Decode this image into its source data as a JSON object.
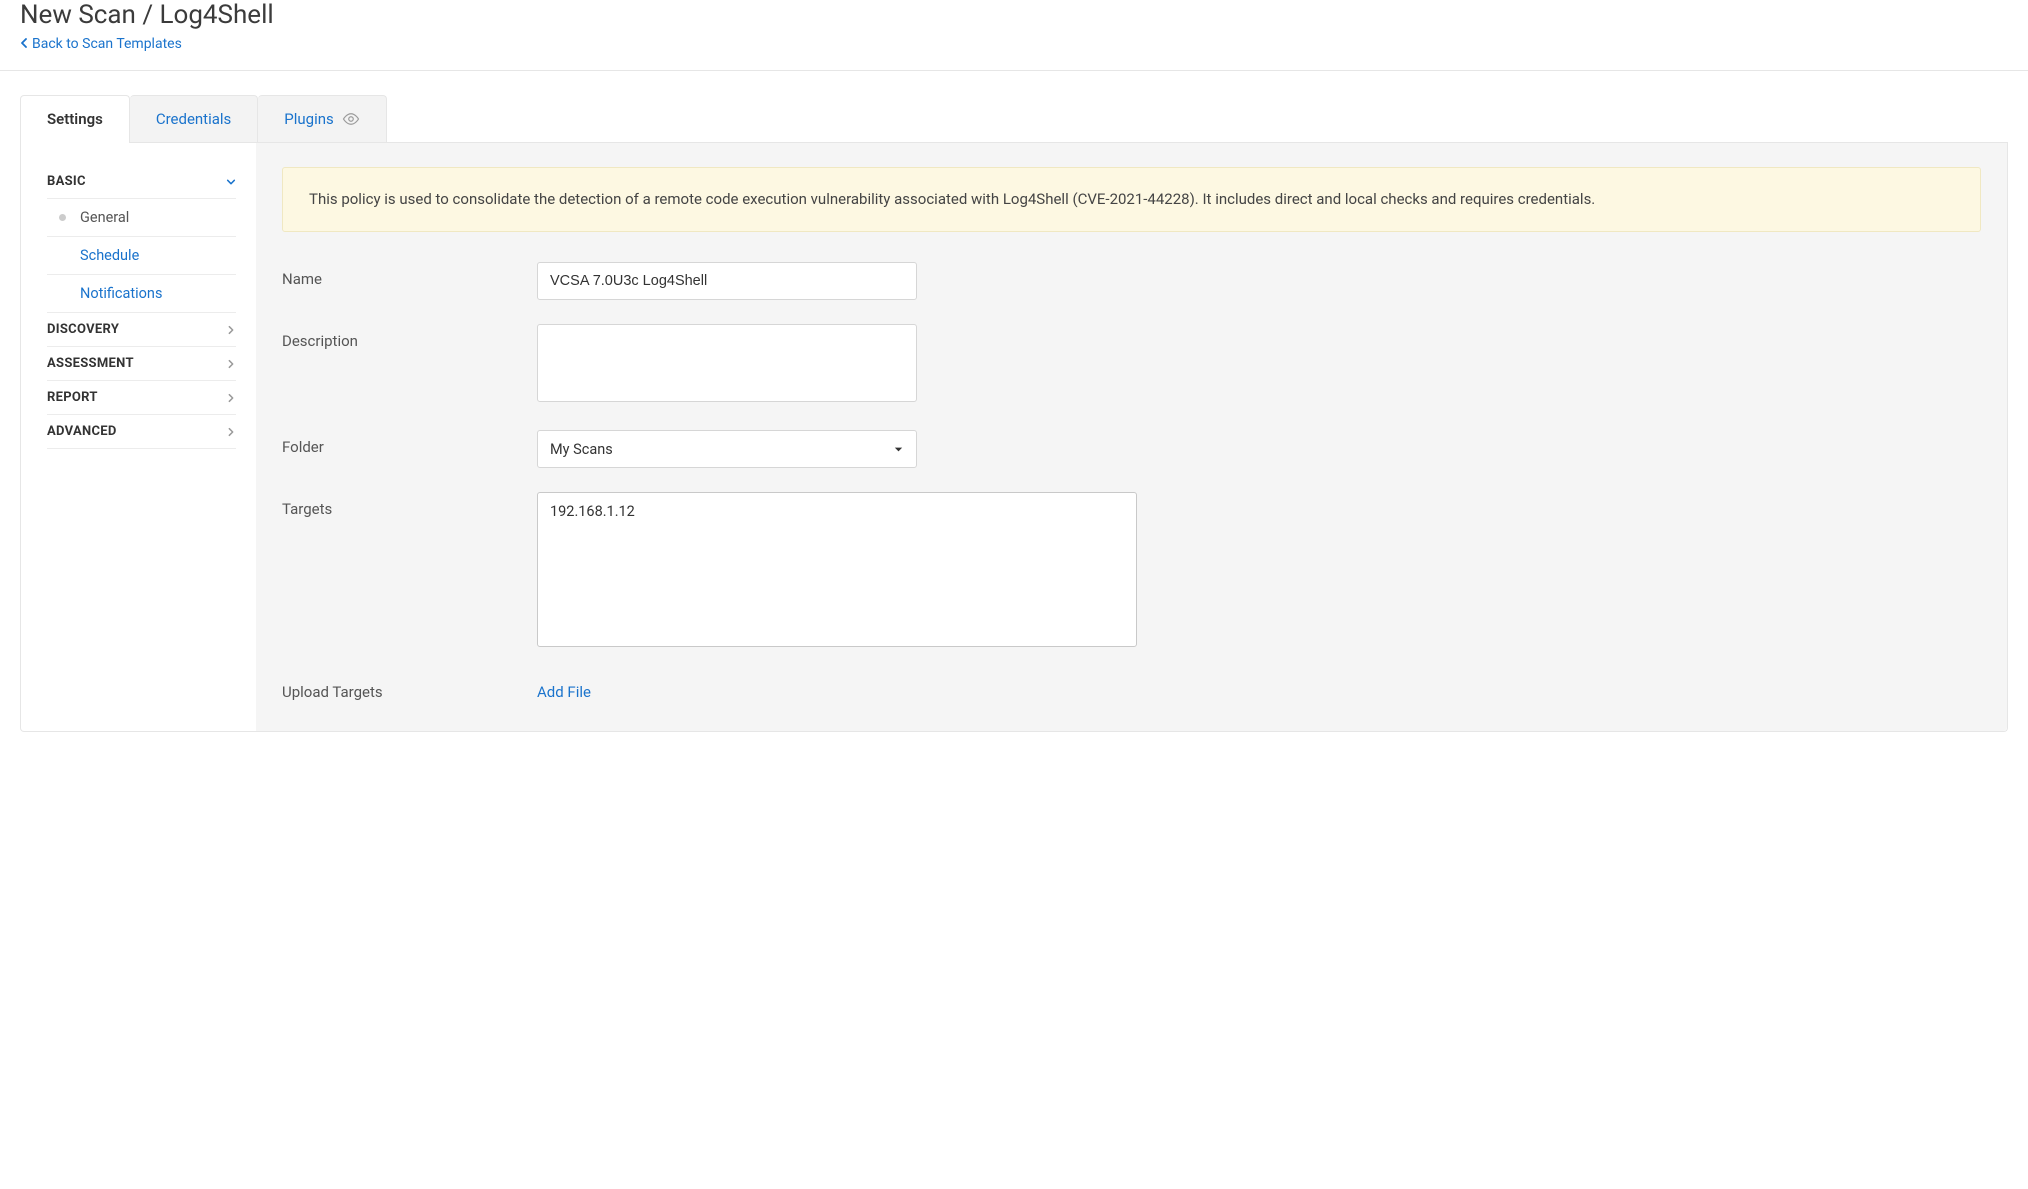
{
  "header": {
    "title": "New Scan / Log4Shell",
    "back_label": "Back to Scan Templates"
  },
  "tabs": {
    "settings": "Settings",
    "credentials": "Credentials",
    "plugins": "Plugins"
  },
  "sidebar": {
    "sections": {
      "basic": "BASIC",
      "discovery": "DISCOVERY",
      "assessment": "ASSESSMENT",
      "report": "REPORT",
      "advanced": "ADVANCED"
    },
    "basic_items": {
      "general": "General",
      "schedule": "Schedule",
      "notifications": "Notifications"
    }
  },
  "banner": {
    "text": "This policy is used to consolidate the detection of a remote code execution vulnerability associated with Log4Shell (CVE-2021-44228). It includes direct and local checks and requires credentials."
  },
  "form": {
    "name_label": "Name",
    "name_value": "VCSA 7.0U3c Log4Shell",
    "description_label": "Description",
    "description_value": "",
    "folder_label": "Folder",
    "folder_value": "My Scans",
    "targets_label": "Targets",
    "targets_value": "192.168.1.12",
    "upload_label": "Upload Targets",
    "add_file_label": "Add File"
  }
}
